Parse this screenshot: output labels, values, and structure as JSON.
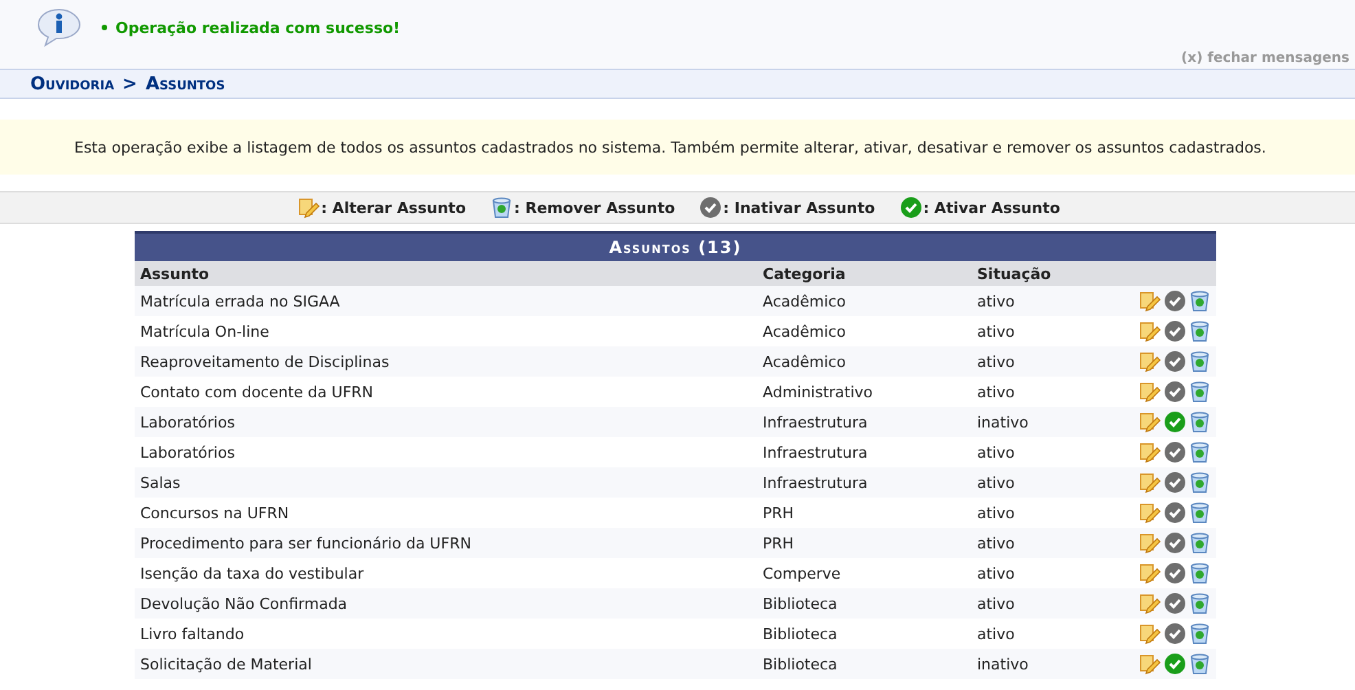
{
  "message": {
    "text": "Operação realizada com sucesso!",
    "close": "(x) fechar mensagens"
  },
  "breadcrumb": {
    "parts": [
      "Ouvidoria",
      ">",
      "Assuntos"
    ]
  },
  "description": "Esta operação exibe a listagem de todos os assuntos cadastrados no sistema. Também permite alterar, ativar, desativar e remover os assuntos cadastrados.",
  "legend": [
    {
      "kind": "edit",
      "label": ": Alterar Assunto"
    },
    {
      "kind": "remove",
      "label": ": Remover Assunto"
    },
    {
      "kind": "deactivate",
      "label": ": Inativar Assunto"
    },
    {
      "kind": "activate",
      "label": ": Ativar Assunto"
    }
  ],
  "table": {
    "caption": "Assuntos (13)",
    "columns": [
      "Assunto",
      "Categoria",
      "Situação"
    ],
    "rows": [
      {
        "assunto": "Matrícula errada no SIGAA",
        "categoria": "Acadêmico",
        "situacao": "ativo",
        "active": true
      },
      {
        "assunto": "Matrícula On-line",
        "categoria": "Acadêmico",
        "situacao": "ativo",
        "active": true
      },
      {
        "assunto": "Reaproveitamento de Disciplinas",
        "categoria": "Acadêmico",
        "situacao": "ativo",
        "active": true
      },
      {
        "assunto": "Contato com docente da UFRN",
        "categoria": "Administrativo",
        "situacao": "ativo",
        "active": true
      },
      {
        "assunto": "Laboratórios",
        "categoria": "Infraestrutura",
        "situacao": "inativo",
        "active": false
      },
      {
        "assunto": "Laboratórios",
        "categoria": "Infraestrutura",
        "situacao": "ativo",
        "active": true
      },
      {
        "assunto": "Salas",
        "categoria": "Infraestrutura",
        "situacao": "ativo",
        "active": true
      },
      {
        "assunto": "Concursos na UFRN",
        "categoria": "PRH",
        "situacao": "ativo",
        "active": true
      },
      {
        "assunto": "Procedimento para ser funcionário da UFRN",
        "categoria": "PRH",
        "situacao": "ativo",
        "active": true
      },
      {
        "assunto": "Isenção da taxa do vestibular",
        "categoria": "Comperve",
        "situacao": "ativo",
        "active": true
      },
      {
        "assunto": "Devolução Não Confirmada",
        "categoria": "Biblioteca",
        "situacao": "ativo",
        "active": true
      },
      {
        "assunto": "Livro faltando",
        "categoria": "Biblioteca",
        "situacao": "ativo",
        "active": true
      },
      {
        "assunto": "Solicitação de Material",
        "categoria": "Biblioteca",
        "situacao": "inativo",
        "active": false
      }
    ]
  }
}
